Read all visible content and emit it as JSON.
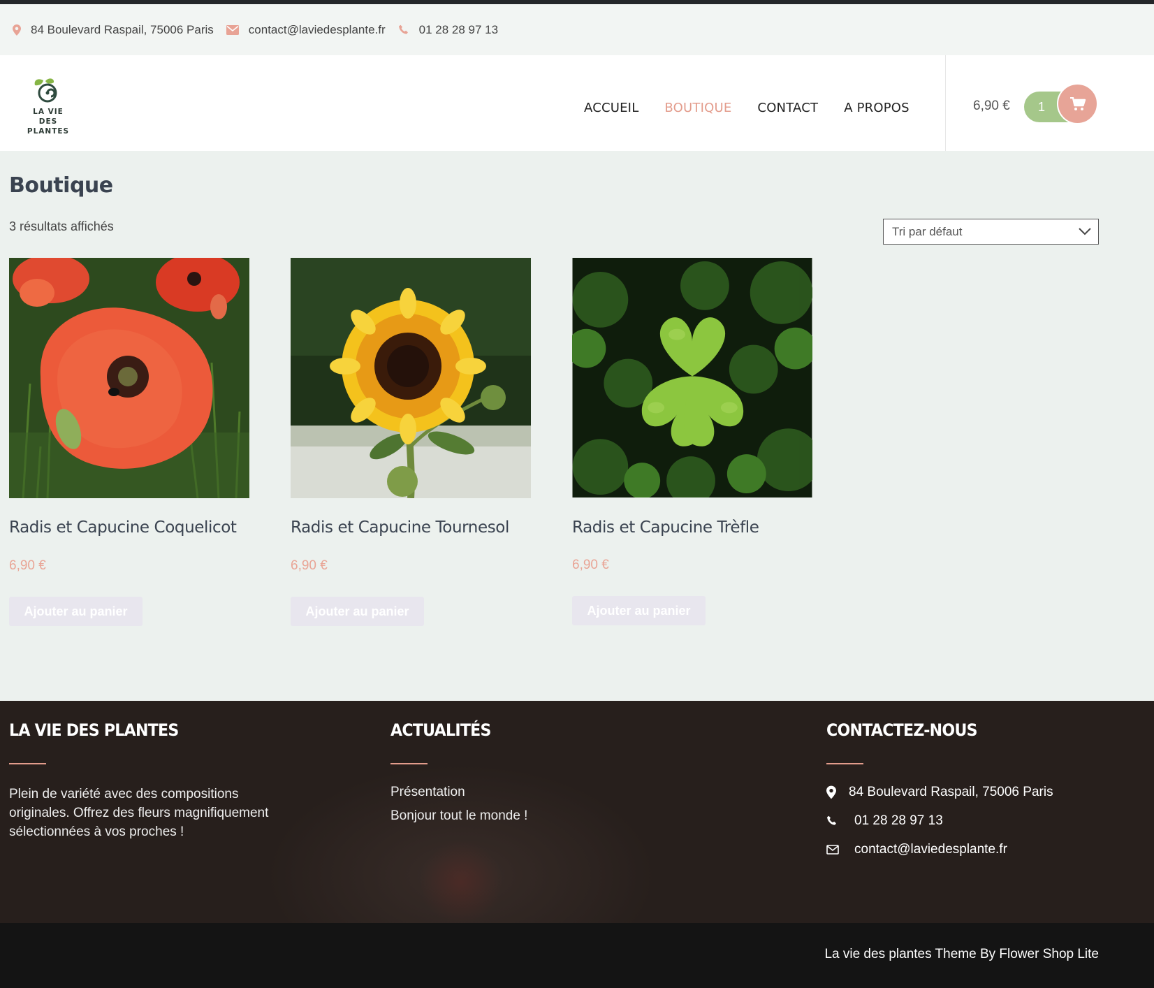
{
  "topbar": {
    "address": "84 Boulevard Raspail, 75006 Paris",
    "email": "contact@laviedesplante.fr",
    "phone": "01 28 28 97 13"
  },
  "brand": {
    "logo_text": "LA VIE DES PLANTES",
    "accent_color": "#e39c8c",
    "green_color": "#a5c78a"
  },
  "nav": {
    "items": [
      {
        "label": "ACCUEIL",
        "active": false
      },
      {
        "label": "BOUTIQUE",
        "active": true
      },
      {
        "label": "CONTACT",
        "active": false
      },
      {
        "label": "A PROPOS",
        "active": false
      }
    ]
  },
  "cart": {
    "total": "6,90 €",
    "count": "1",
    "icon": "cart-icon"
  },
  "shop": {
    "title": "Boutique",
    "result_count": "3 résultats affichés",
    "sort_selected": "Tri par défaut",
    "products": [
      {
        "name": "Radis et Capucine Coquelicot",
        "price": "6,90 €",
        "button": "Ajouter au panier",
        "image": "red-poppy"
      },
      {
        "name": "Radis et Capucine Tournesol",
        "price": "6,90 €",
        "button": "Ajouter au panier",
        "image": "sunflower"
      },
      {
        "name": "Radis et Capucine Trèfle",
        "price": "6,90 €",
        "button": "Ajouter au panier",
        "image": "clover"
      }
    ]
  },
  "footer": {
    "about": {
      "title": "LA VIE DES PLANTES",
      "text": "Plein de variété avec des compositions originales. Offrez des fleurs magnifiquement sélectionnées à vos proches !"
    },
    "news": {
      "title": "ACTUALITÉS",
      "links": [
        "Présentation",
        "Bonjour tout le monde !"
      ]
    },
    "contact": {
      "title": "CONTACTEZ-NOUS",
      "address": "84 Boulevard Raspail, 75006 Paris",
      "phone": "01 28 28 97 13",
      "email": "contact@laviedesplante.fr"
    },
    "credit": "La vie des plantes Theme By Flower Shop Lite"
  }
}
